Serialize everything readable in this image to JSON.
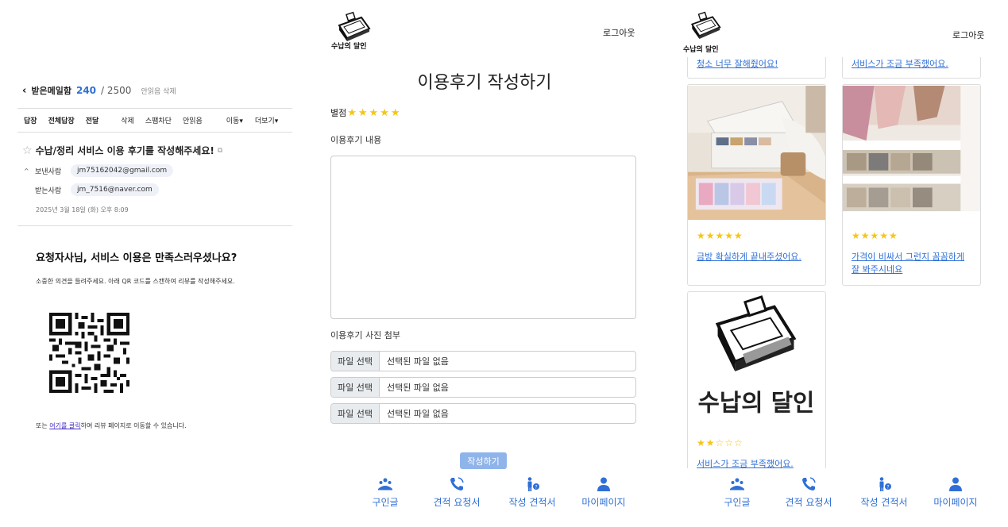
{
  "mail": {
    "back_label": "받은메일함",
    "count": "240",
    "total": "/ 2500",
    "unread_delete": "안읽음 삭제",
    "toolbar": [
      "답장",
      "전체답장",
      "전달",
      "삭제",
      "스팸차단",
      "안읽음",
      "이동▾",
      "더보기▾"
    ],
    "subject": "수납/정리 서비스 이용 후기를 작성해주세요!",
    "sender_label": "보낸사람",
    "sender": "jm75162042@gmail.com",
    "receiver_label": "받는사람",
    "receiver": "jm_7516@naver.com",
    "date": "2025년 3월 18일 (화) 오후 8:09",
    "body_title": "요청자사님, 서비스 이용은 만족스러우셨나요?",
    "body_text": "소중한 의견을 들려주세요. 아래 QR 코드를 스캔하여 리뷰를 작성해주세요.",
    "foot_prefix": "또는 ",
    "foot_link": "여기를 클릭",
    "foot_suffix": "하여 리뷰 페이지로 이동할 수 있습니다."
  },
  "write": {
    "logo_text": "수납의 달인",
    "logout": "로그아웃",
    "title": "이용후기 작성하기",
    "rating_label": "별점",
    "rating_stars": "★★★★★",
    "content_label": "이용후기 내용",
    "photo_label": "이용후기 사진 첨부",
    "file_button": "파일 선택",
    "file_none": "선택된 파일 없음",
    "submit": "작성하기"
  },
  "nav": {
    "items": [
      "구인글",
      "견적 요청서",
      "작성 견적서",
      "마이페이지"
    ],
    "color": "#2f6fd6"
  },
  "reviews": {
    "logo_text": "수납의 달인",
    "logout": "로그아웃",
    "top_cut_left": "청소 너무 잘해줬어요!",
    "top_cut_right": "서비스가 조금 부족했어요.",
    "cards": [
      {
        "stars": "★★★★★",
        "text": "금방 확실하게 끝내주셨어요."
      },
      {
        "stars": "★★★★★",
        "text": "가격이 비싸서 그런지 꼼꼼하게 잘 봐주시네요"
      },
      {
        "stars": "★★☆☆☆",
        "text": "서비스가 조금 부족했어요."
      }
    ],
    "big_logo_text": "수납의 달인"
  },
  "colors": {
    "accent": "#2f6fd6",
    "star": "#f5c518",
    "submit_bg": "#8fb4ea"
  }
}
